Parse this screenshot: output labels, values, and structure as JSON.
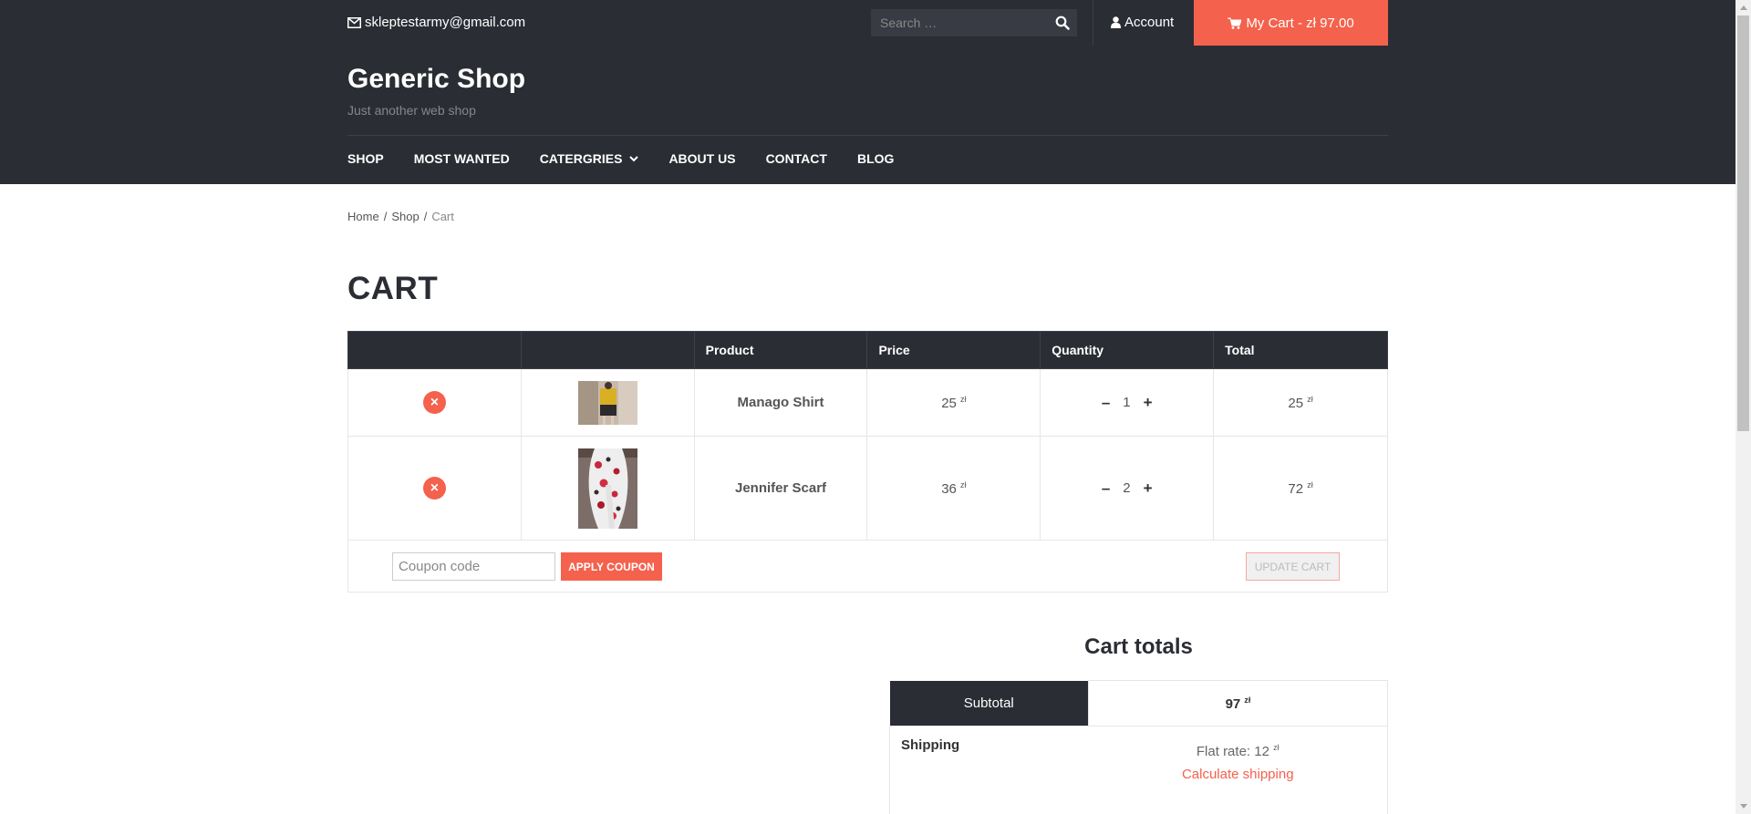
{
  "topbar": {
    "email": "skleptestarmy@gmail.com",
    "search_placeholder": "Search …",
    "account_label": "Account",
    "cart_label": "My Cart - zł 97.00"
  },
  "header": {
    "site_title": "Generic Shop",
    "tagline": "Just another web shop",
    "nav": [
      "SHOP",
      "MOST WANTED",
      "CATERGRIES",
      "ABOUT US",
      "CONTACT",
      "BLOG"
    ]
  },
  "breadcrumb": {
    "home": "Home",
    "shop": "Shop",
    "current": "Cart",
    "sep": "/"
  },
  "page_title": "CART",
  "cart": {
    "headers": [
      "",
      "",
      "Product",
      "Price",
      "Quantity",
      "Total"
    ],
    "currency": "zł",
    "items": [
      {
        "name": "Manago Shirt",
        "price": "25",
        "qty": "1",
        "total": "25"
      },
      {
        "name": "Jennifer Scarf",
        "price": "36",
        "qty": "2",
        "total": "72"
      }
    ],
    "coupon_placeholder": "Coupon code",
    "apply_label": "APPLY COUPON",
    "update_label": "UPDATE CART",
    "qty_minus": "–",
    "qty_plus": "+"
  },
  "totals": {
    "title": "Cart totals",
    "subtotal_label": "Subtotal",
    "subtotal_value": "97",
    "shipping_label": "Shipping",
    "shipping_value": "Flat rate: 12",
    "calc_shipping": "Calculate shipping"
  },
  "colors": {
    "dark": "#2b2d34",
    "accent": "#f4614c"
  }
}
